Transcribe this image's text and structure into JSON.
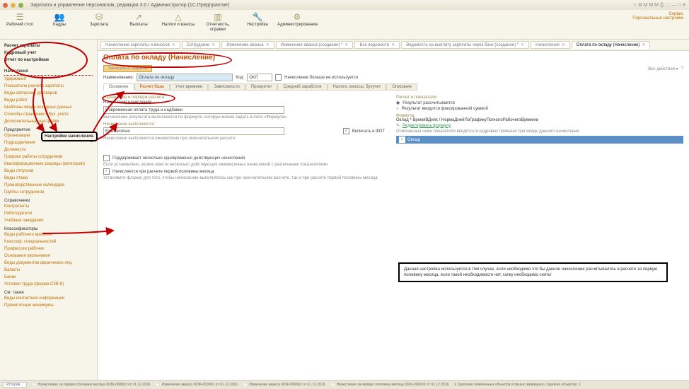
{
  "window": {
    "title": "Зарплата и управление персоналом, редакция 3.0 / Администратор  (1С:Предприятие)"
  },
  "toolbar": [
    {
      "icon": "☰",
      "label": "Рабочий стол"
    },
    {
      "icon": "👥",
      "label": "Кадры"
    },
    {
      "icon": "⛁",
      "label": "Зарплата"
    },
    {
      "icon": "↗",
      "label": "Выплаты"
    },
    {
      "icon": "△",
      "label": "Налоги и взносы"
    },
    {
      "icon": "▥",
      "label": "Отчетность, справки"
    },
    {
      "icon": "🔧",
      "label": "Настройка"
    },
    {
      "icon": "⚙",
      "label": "Администрирование"
    }
  ],
  "service": {
    "l1": "Сервис",
    "l2": "Персональные настройки"
  },
  "sidebar": {
    "top": [
      "Расчет зарплаты",
      "Кадровый учет",
      "Отчет по настройкам"
    ],
    "sel": "Начисления",
    "g1": [
      "Удержания",
      "Показатели расчета зарплаты",
      "Виды авторских договоров",
      "Виды работ",
      "Шаблоны ввода исходных данных",
      "Способы отражения в бух. учете",
      "Дополнительные настройки"
    ],
    "g2h": "Предприятие",
    "g2": [
      "Организации",
      "Подразделения",
      "Должности",
      "Графики работы сотрудников",
      "Квалификационные разряды (категории)",
      "Виды отпусков",
      "Виды стажа",
      "Производственные календари",
      "Группы сотрудников"
    ],
    "g3h": "Справочники",
    "g3": [
      "Контрагенты",
      "Работодатели",
      "Учебные заведения"
    ],
    "g4h": "Классификаторы",
    "g4": [
      "Виды рабочего времени",
      "Классиф. специальностей",
      "Профессии рабочих",
      "Основания увольнения",
      "Виды документов физических лиц",
      "Валюты",
      "Банки",
      "Условия труда (форма СЗВ-К)"
    ],
    "g5h": "См. также",
    "g5": [
      "Виды контактной информации",
      "Прожиточные минимумы"
    ]
  },
  "callout": "Настройки начисления.",
  "tabs": [
    "Начисление зарплаты и взносов",
    "Сотрудники",
    "Изменение аванса",
    "Изменение аванса (создание) *",
    "Все ведомости",
    "Ведомость на выплату зарплаты через банк (создание) *",
    "Начисления",
    "Оплата по окладу (Начисление)"
  ],
  "form": {
    "title": "Оплата по окладу (Начисление)",
    "saveclose": "Записать и закрыть",
    "all": "Все действия ▾",
    "name_l": "Наименование:",
    "name_v": "Оплата по окладу",
    "code_l": "Код:",
    "code_v": "ОКЛ",
    "chk_notused": "Начисление больше не используется",
    "subtabs": [
      "Основное",
      "Расчет базы",
      "Учет времени",
      "Зависимости",
      "Приоритет",
      "Средний заработок",
      "Налоги, взносы, бухучет",
      "Описание"
    ],
    "purpose_h": "Назначение и порядок расчета",
    "purpose_l": "Назначение начисления:",
    "purpose_v": "Повременная оплата труда и надбавки",
    "calc_l": "Вычисление результата выполняется по формуле, которую можно задать в поле «Формула».",
    "exec_l": "Начисление выполняется:",
    "exec_v": "Ежемесячно",
    "infot": "Включать в ФОТ",
    "exec_note": "Начисление выполняется ежемесячно при окончательном расчете",
    "multi": "Поддерживает несколько одновременно действующих начислений",
    "multi_note": "Если установлено, можно ввести несколько действующих ежемесячных начислений с различными показателями",
    "firsthalf": "Начисляется при расчете первой половины месяца",
    "firsthalf_note": "Установите флажок для того, чтобы начисление выполнялось как при окончательном расчете, так и при расчете первой половины месяца",
    "right_h": "Расчет и показатели",
    "r1": "Результат рассчитывается",
    "r2": "Результат вводится фиксированной суммой",
    "formula_l": "Формула:",
    "formula_v": "Оклад * ВремяВДнях / НормаДнейПоГрафикуПолногоРабочегоВремени",
    "editf": "Редактировать формулу",
    "listnote": "Отмеченные ниже показатели вводятся в кадровых приказах при вводе данного начисления",
    "oklad": "Оклад"
  },
  "bigcallout": "Данная настройка используется в том случае, если необходимо что бы данное начисление расчитывалось в расчете за первую половину месяца, если такой необходимости нет, галку необходимо снять!",
  "status": {
    "history": "История...",
    "items": [
      "Начисление за первую половину месяца 003К-000003 от 01.12.2016",
      "Изменение аванса 003К-000001 от 01.12.2016",
      "Изменение аванса 003К-000002 от 01.12.2016",
      "Начисление за первую половину месяца 003К-000002 от 01.12.2016",
      "Удаление помеченных объектов успешно завершено. Удалено объектов: 2"
    ]
  }
}
